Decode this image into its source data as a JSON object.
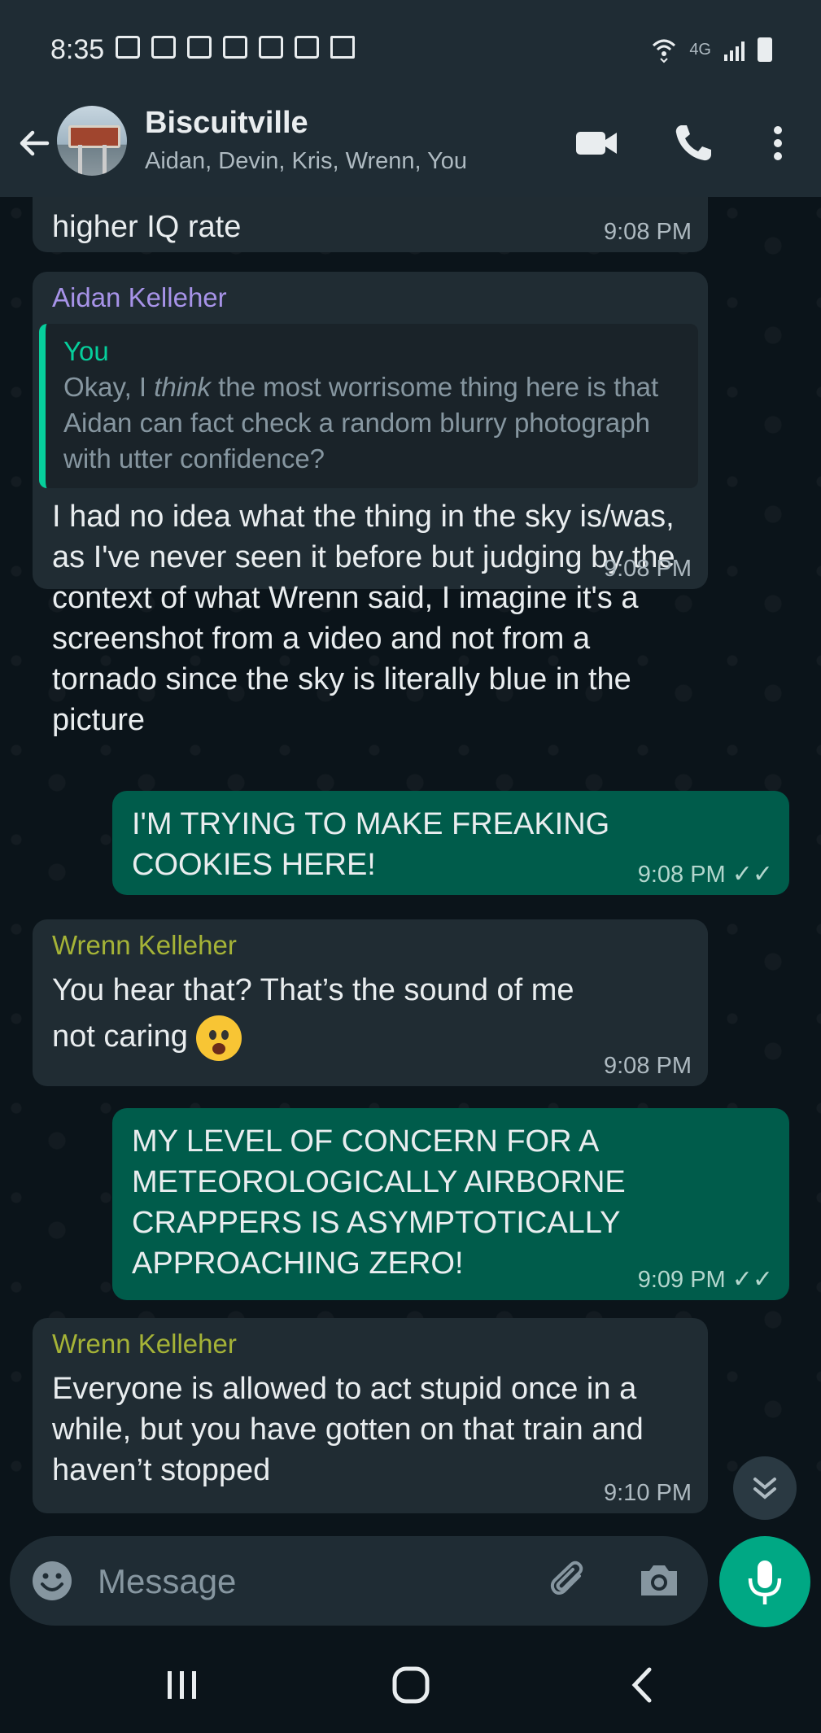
{
  "status_bar": {
    "time": "8:35",
    "network": "4G"
  },
  "header": {
    "title": "Biscuitville",
    "participants": "Aidan, Devin, Kris, Wrenn, You"
  },
  "messages": [
    {
      "direction": "in",
      "sender": "",
      "text": "higher IQ rate",
      "time": "9:08 PM"
    },
    {
      "direction": "in",
      "sender": "Aidan Kelleher",
      "sender_color": "#a793e8",
      "quote": {
        "name": "You",
        "text_before": "Okay, I ",
        "text_emph": "think",
        "text_after": " the most worrisome thing here is that Aidan can fact check a random blurry photograph with utter confidence?"
      },
      "text": "I had no idea what the thing in the sky is/was, as I've never seen it before but judging by the context of what Wrenn said, I imagine it's a screenshot from a video and not from a tornado since the sky is literally blue in the picture",
      "time": "9:08 PM"
    },
    {
      "direction": "out",
      "text": "I'M TRYING TO MAKE FREAKING COOKIES HERE!",
      "time": "9:08 PM",
      "ticks": "✓✓"
    },
    {
      "direction": "in",
      "sender": "Wrenn Kelleher",
      "sender_color": "#a5b337",
      "text_line1": "You hear that? That’s the sound of me",
      "text_line2": "not caring",
      "emoji": "face-screaming-in-fear",
      "time": "9:08 PM"
    },
    {
      "direction": "out",
      "text": "MY LEVEL OF CONCERN FOR A METEOROLOGICALLY AIRBORNE CRAPPERS IS ASYMPTOTICALLY APPROACHING ZERO!",
      "time": "9:09 PM",
      "ticks": "✓✓"
    },
    {
      "direction": "in",
      "sender": "Wrenn Kelleher",
      "sender_color": "#a5b337",
      "text": "Everyone is allowed to act stupid once in a while, but you have gotten on that train and haven’t stopped",
      "time": "9:10 PM"
    }
  ],
  "composer": {
    "placeholder": "Message"
  },
  "colors": {
    "incoming_bubble": "#202c33",
    "outgoing_bubble": "#005c4b",
    "accent": "#00a884",
    "quote_bar": "#06cf9c"
  }
}
